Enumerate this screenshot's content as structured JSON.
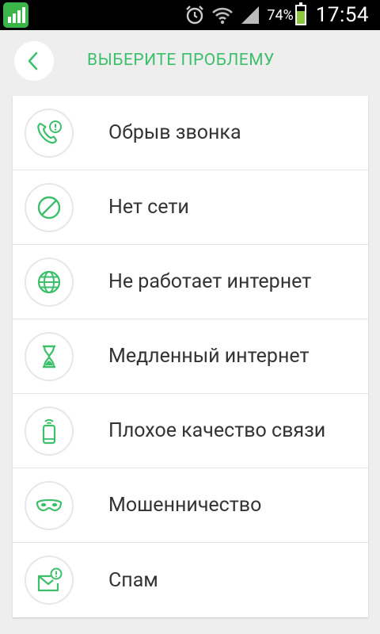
{
  "status_bar": {
    "battery_percent": "74%",
    "time": "17:54"
  },
  "header": {
    "title": "ВЫБЕРИТЕ ПРОБЛЕМУ"
  },
  "colors": {
    "accent": "#3dbf6b",
    "app_badge": "#39b54a",
    "battery_fill": "#8cc63f"
  },
  "problems": [
    {
      "label": "Обрыв звонка",
      "icon": "phone-alert-icon"
    },
    {
      "label": "Нет сети",
      "icon": "no-signal-icon"
    },
    {
      "label": "Не работает интернет",
      "icon": "globe-icon"
    },
    {
      "label": "Медленный интернет",
      "icon": "hourglass-icon"
    },
    {
      "label": "Плохое качество связи",
      "icon": "phone-signal-icon"
    },
    {
      "label": "Мошенничество",
      "icon": "mask-icon"
    },
    {
      "label": "Спам",
      "icon": "mail-alert-icon"
    }
  ]
}
